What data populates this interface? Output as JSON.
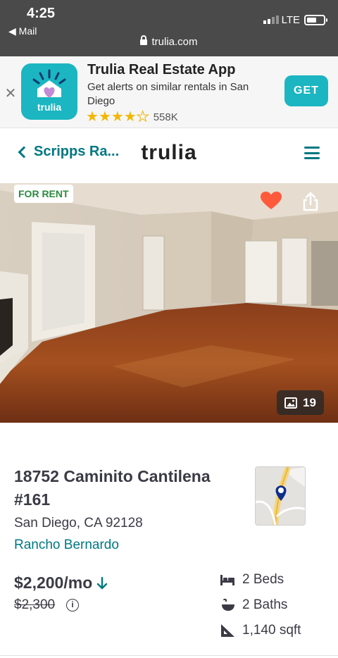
{
  "status_bar": {
    "time": "4:25",
    "back_label": "◀ Mail",
    "network": "LTE",
    "url": "trulia.com",
    "signal_bars": 4,
    "signal_filled": 2,
    "battery_level": 0.6
  },
  "app_banner": {
    "close_glyph": "✕",
    "icon_label": "trulia",
    "title": "Trulia Real Estate App",
    "subtitle": "Get alerts on similar rentals in San Diego",
    "rating": 4.5,
    "rating_count": "558K",
    "get_label": "GET",
    "accent_color": "#1bb6c1"
  },
  "nav": {
    "back_label": "Scripps Ra...",
    "logo_text": "trulia",
    "accent_color": "#007882"
  },
  "photo": {
    "badge": "FOR RENT",
    "favorited": true,
    "photo_count": "19"
  },
  "listing": {
    "address": "18752 Caminito Cantilena #161",
    "city_state_zip": "San Diego, CA 92128",
    "neighborhood": "Rancho Bernardo",
    "price": "$2,200/mo",
    "old_price": "$2,300",
    "info_glyph": "i",
    "beds": "2 Beds",
    "baths": "2 Baths",
    "sqft": "1,140 sqft"
  }
}
